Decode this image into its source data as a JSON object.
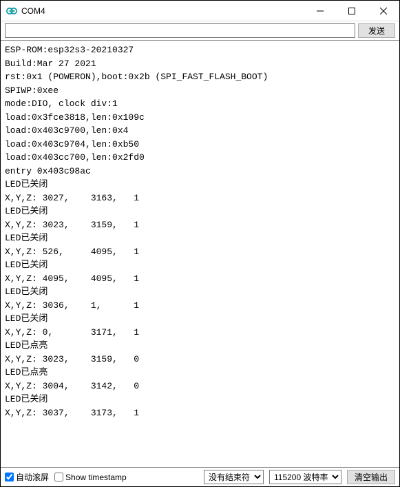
{
  "window": {
    "title": "COM4"
  },
  "toolbar": {
    "input_value": "",
    "input_placeholder": "",
    "send_label": "发送"
  },
  "console": {
    "lines": [
      "ESP-ROM:esp32s3-20210327",
      "Build:Mar 27 2021",
      "rst:0x1 (POWERON),boot:0x2b (SPI_FAST_FLASH_BOOT)",
      "SPIWP:0xee",
      "mode:DIO, clock div:1",
      "load:0x3fce3818,len:0x109c",
      "load:0x403c9700,len:0x4",
      "load:0x403c9704,len:0xb50",
      "load:0x403cc700,len:0x2fd0",
      "entry 0x403c98ac",
      "LED已关闭",
      "X,Y,Z: 3027,    3163,   1",
      "LED已关闭",
      "X,Y,Z: 3023,    3159,   1",
      "LED已关闭",
      "X,Y,Z: 526,     4095,   1",
      "LED已关闭",
      "X,Y,Z: 4095,    4095,   1",
      "LED已关闭",
      "X,Y,Z: 3036,    1,      1",
      "LED已关闭",
      "X,Y,Z: 0,       3171,   1",
      "LED已点亮",
      "X,Y,Z: 3023,    3159,   0",
      "LED已点亮",
      "X,Y,Z: 3004,    3142,   0",
      "LED已关闭",
      "X,Y,Z: 3037,    3173,   1"
    ]
  },
  "footer": {
    "autoscroll_label": "自动滚屏",
    "autoscroll_checked": true,
    "timestamp_label": "Show timestamp",
    "timestamp_checked": false,
    "line_ending": "没有结束符",
    "baud_rate": "115200 波特率",
    "clear_label": "清空输出"
  }
}
